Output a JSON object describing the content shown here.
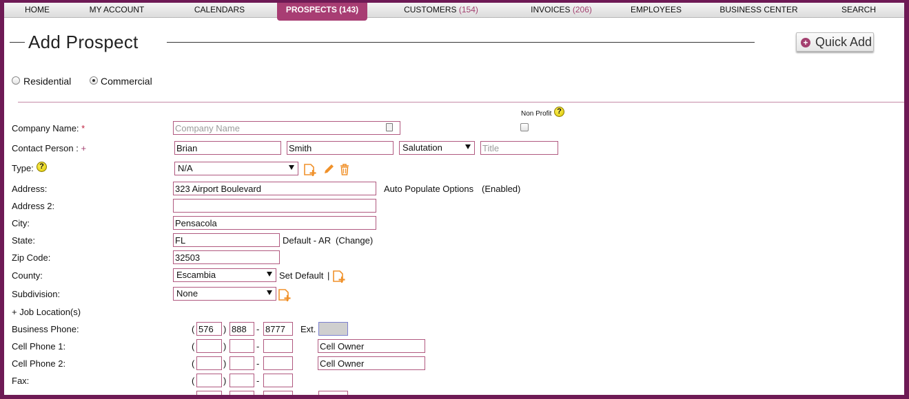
{
  "nav": {
    "items": [
      {
        "label": "HOME",
        "count": ""
      },
      {
        "label": "MY ACCOUNT",
        "count": ""
      },
      {
        "label": "CALENDARS",
        "count": ""
      },
      {
        "label": "PROSPECTS (143)",
        "count": ""
      },
      {
        "label": "CUSTOMERS",
        "count": "(154)"
      },
      {
        "label": "INVOICES",
        "count": "(206)"
      },
      {
        "label": "EMPLOYEES",
        "count": ""
      },
      {
        "label": "BUSINESS CENTER",
        "count": ""
      },
      {
        "label": "SEARCH",
        "count": ""
      }
    ]
  },
  "header": {
    "title": "Add Prospect",
    "quick_add": "Quick Add"
  },
  "prospect_type": {
    "residential": "Residential",
    "commercial": "Commercial",
    "selected": "Commercial"
  },
  "form": {
    "non_profit_label": "Non Profit",
    "company_name": {
      "label": "Company Name:",
      "required_mark": "*",
      "placeholder": "Company Name",
      "value": ""
    },
    "contact_person": {
      "label": "Contact Person :",
      "add_mark": "+",
      "first": "Brian",
      "last": "Smith",
      "salutation": "Salutation",
      "title_placeholder": "Title"
    },
    "type": {
      "label": "Type:",
      "value": "N/A"
    },
    "address": {
      "label": "Address:",
      "value": "323 Airport Boulevard",
      "auto_link": "Auto Populate Options",
      "auto_status": "(Enabled)"
    },
    "address2": {
      "label": "Address 2:",
      "value": ""
    },
    "city": {
      "label": "City:",
      "value": "Pensacola"
    },
    "state": {
      "label": "State:",
      "value": "FL",
      "default_text": "Default - AR",
      "change_link": "(Change)"
    },
    "zip": {
      "label": "Zip Code:",
      "value": "32503"
    },
    "county": {
      "label": "County:",
      "value": "Escambia",
      "set_default": "Set Default",
      "separator": "|"
    },
    "subdivision": {
      "label": "Subdivision:",
      "value": "None"
    },
    "job_locations": "+ Job Location(s)",
    "business_phone": {
      "label": "Business Phone:",
      "area": "576",
      "prefix": "888",
      "line": "8777",
      "ext_label": "Ext.",
      "ext": ""
    },
    "cell_phone1": {
      "label": "Cell Phone 1:",
      "owner_value": "Cell Owner"
    },
    "cell_phone2": {
      "label": "Cell Phone 2:",
      "owner_value": "Cell Owner"
    },
    "fax": {
      "label": "Fax:"
    },
    "paren_open": "(",
    "paren_close": ")",
    "dash": "-"
  }
}
